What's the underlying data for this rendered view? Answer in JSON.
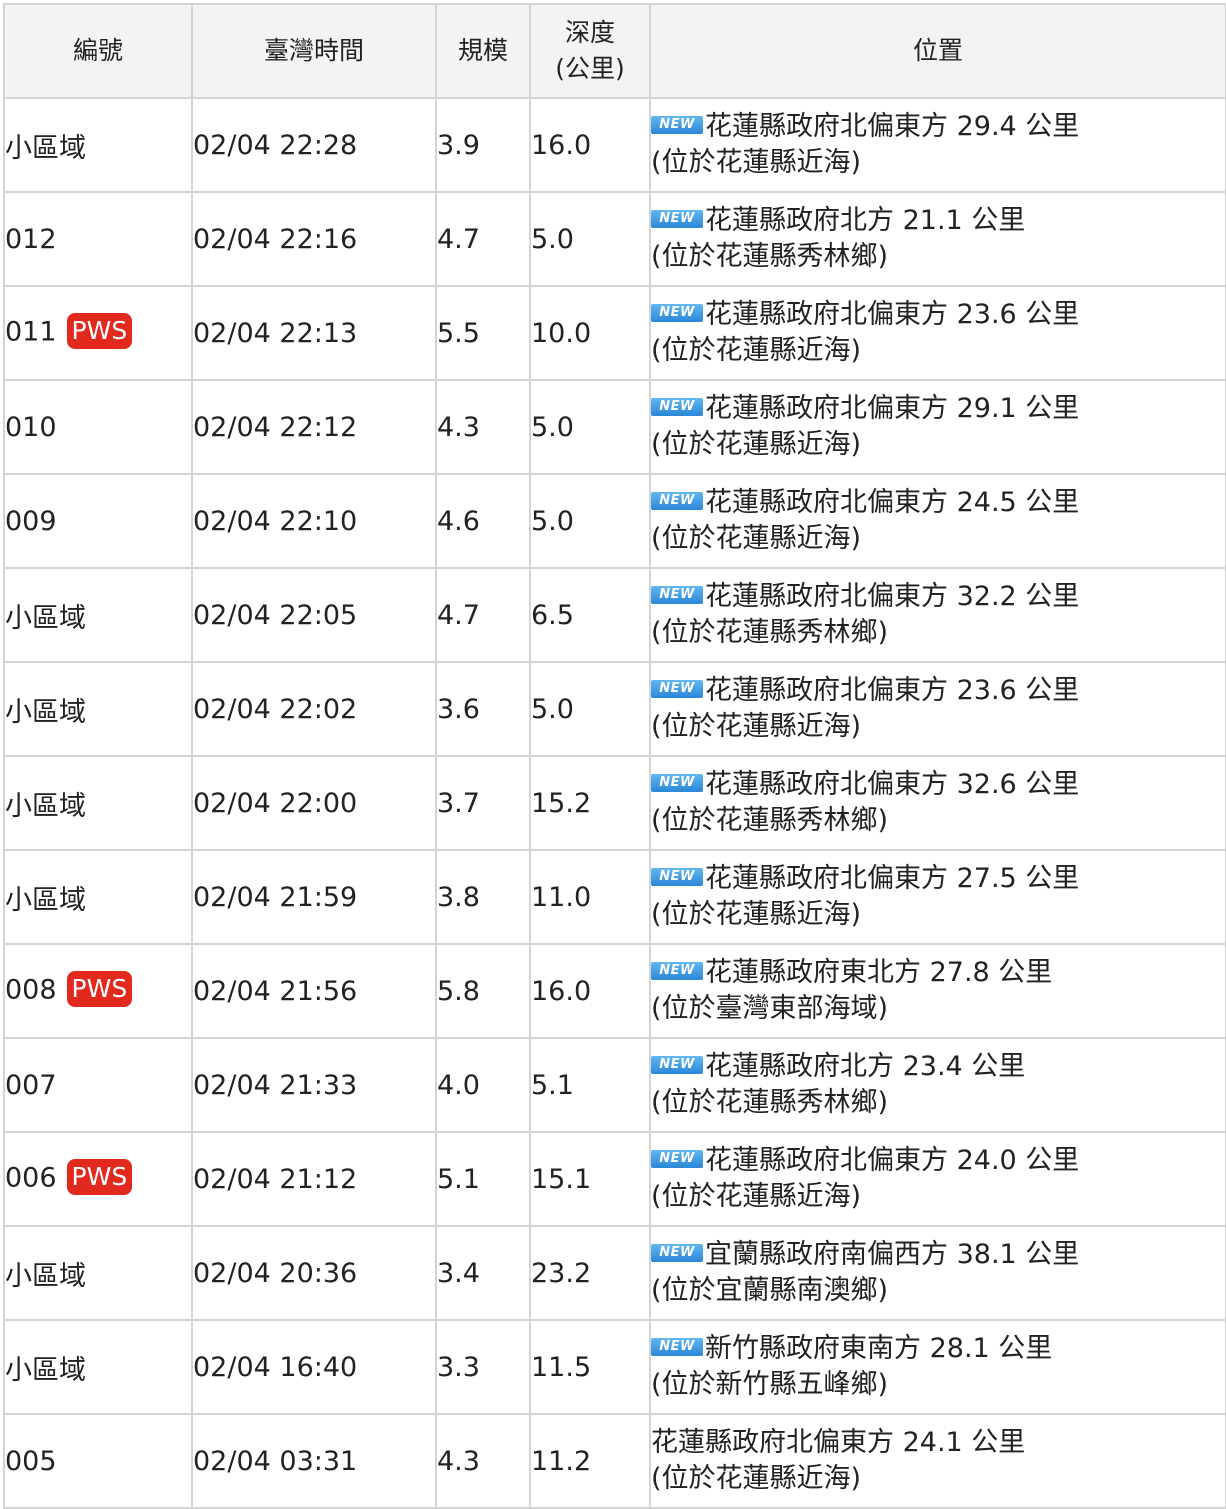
{
  "header": {
    "id": "編號",
    "time": "臺灣時間",
    "magnitude": "規模",
    "depth_line1": "深度",
    "depth_line2": "(公里)",
    "location": "位置"
  },
  "badges": {
    "new": "NEW",
    "pws": "PWS"
  },
  "rows": [
    {
      "id": "小區域",
      "pws": false,
      "time": "02/04 22:28",
      "mag": "3.9",
      "depth": "16.0",
      "new": true,
      "loc1": "花蓮縣政府北偏東方 29.4 公里",
      "loc2": "(位於花蓮縣近海)"
    },
    {
      "id": "012",
      "pws": false,
      "time": "02/04 22:16",
      "mag": "4.7",
      "depth": "5.0",
      "new": true,
      "loc1": "花蓮縣政府北方 21.1 公里",
      "loc2": "(位於花蓮縣秀林鄉)"
    },
    {
      "id": "011",
      "pws": true,
      "time": "02/04 22:13",
      "mag": "5.5",
      "depth": "10.0",
      "new": true,
      "loc1": "花蓮縣政府北偏東方 23.6 公里",
      "loc2": "(位於花蓮縣近海)"
    },
    {
      "id": "010",
      "pws": false,
      "time": "02/04 22:12",
      "mag": "4.3",
      "depth": "5.0",
      "new": true,
      "loc1": "花蓮縣政府北偏東方 29.1 公里",
      "loc2": "(位於花蓮縣近海)"
    },
    {
      "id": "009",
      "pws": false,
      "time": "02/04 22:10",
      "mag": "4.6",
      "depth": "5.0",
      "new": true,
      "loc1": "花蓮縣政府北偏東方 24.5 公里",
      "loc2": "(位於花蓮縣近海)"
    },
    {
      "id": "小區域",
      "pws": false,
      "time": "02/04 22:05",
      "mag": "4.7",
      "depth": "6.5",
      "new": true,
      "loc1": "花蓮縣政府北偏東方 32.2 公里",
      "loc2": "(位於花蓮縣秀林鄉)"
    },
    {
      "id": "小區域",
      "pws": false,
      "time": "02/04 22:02",
      "mag": "3.6",
      "depth": "5.0",
      "new": true,
      "loc1": "花蓮縣政府北偏東方 23.6 公里",
      "loc2": "(位於花蓮縣近海)"
    },
    {
      "id": "小區域",
      "pws": false,
      "time": "02/04 22:00",
      "mag": "3.7",
      "depth": "15.2",
      "new": true,
      "loc1": "花蓮縣政府北偏東方 32.6 公里",
      "loc2": "(位於花蓮縣秀林鄉)"
    },
    {
      "id": "小區域",
      "pws": false,
      "time": "02/04 21:59",
      "mag": "3.8",
      "depth": "11.0",
      "new": true,
      "loc1": "花蓮縣政府北偏東方 27.5 公里",
      "loc2": "(位於花蓮縣近海)"
    },
    {
      "id": "008",
      "pws": true,
      "time": "02/04 21:56",
      "mag": "5.8",
      "depth": "16.0",
      "new": true,
      "loc1": "花蓮縣政府東北方 27.8 公里",
      "loc2": "(位於臺灣東部海域)"
    },
    {
      "id": "007",
      "pws": false,
      "time": "02/04 21:33",
      "mag": "4.0",
      "depth": "5.1",
      "new": true,
      "loc1": "花蓮縣政府北方 23.4 公里",
      "loc2": "(位於花蓮縣秀林鄉)"
    },
    {
      "id": "006",
      "pws": true,
      "time": "02/04 21:12",
      "mag": "5.1",
      "depth": "15.1",
      "new": true,
      "loc1": "花蓮縣政府北偏東方 24.0 公里",
      "loc2": "(位於花蓮縣近海)"
    },
    {
      "id": "小區域",
      "pws": false,
      "time": "02/04 20:36",
      "mag": "3.4",
      "depth": "23.2",
      "new": true,
      "loc1": "宜蘭縣政府南偏西方 38.1 公里",
      "loc2": "(位於宜蘭縣南澳鄉)"
    },
    {
      "id": "小區域",
      "pws": false,
      "time": "02/04 16:40",
      "mag": "3.3",
      "depth": "11.5",
      "new": true,
      "loc1": "新竹縣政府東南方 28.1 公里",
      "loc2": "(位於新竹縣五峰鄉)"
    },
    {
      "id": "005",
      "pws": false,
      "time": "02/04 03:31",
      "mag": "4.3",
      "depth": "11.2",
      "new": false,
      "loc1": "花蓮縣政府北偏東方 24.1 公里",
      "loc2": "(位於花蓮縣近海)"
    }
  ]
}
